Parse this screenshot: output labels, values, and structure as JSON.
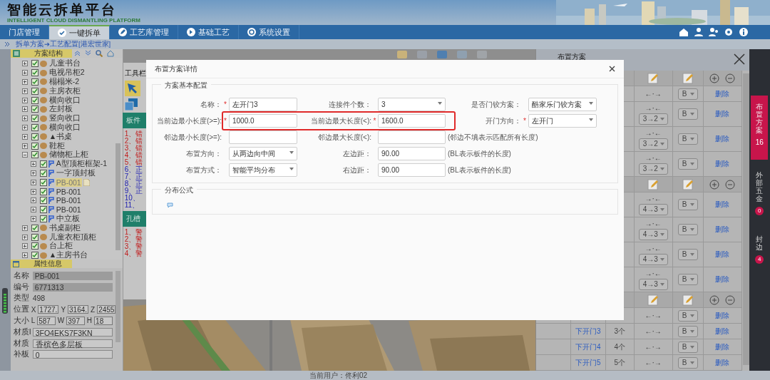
{
  "header": {
    "title": "智能云拆单平台",
    "subtitle": "INTELLIGENT CLOUD DISMANTLING PLATFORM"
  },
  "nav": [
    {
      "label": "门店管理",
      "selected": false
    },
    {
      "label": "一键拆单",
      "selected": true
    },
    {
      "label": "工艺库管理",
      "selected": false
    },
    {
      "label": "基础工艺",
      "selected": false
    },
    {
      "label": "系统设置",
      "selected": false
    }
  ],
  "breadcrumb": "拆单方案➔工艺配置[港宏世家]",
  "tree": {
    "title": "方案结构",
    "items": [
      {
        "label": "儿童书台",
        "kind": "cabinet",
        "checked": true,
        "expanded": false,
        "selected": false
      },
      {
        "label": "电视吊柜2",
        "kind": "cabinet",
        "checked": true,
        "expanded": false,
        "selected": false
      },
      {
        "label": "榻榻米-2",
        "kind": "cabinet",
        "checked": true,
        "expanded": false,
        "selected": false
      },
      {
        "label": "主房衣柜",
        "kind": "cabinet",
        "checked": true,
        "expanded": false,
        "selected": false
      },
      {
        "label": "横向收口",
        "kind": "cabinet",
        "checked": true,
        "expanded": false,
        "selected": false
      },
      {
        "label": "左封板",
        "kind": "cabinet",
        "checked": true,
        "expanded": false,
        "selected": false
      },
      {
        "label": "竖向收口",
        "kind": "cabinet",
        "checked": true,
        "expanded": false,
        "selected": false
      },
      {
        "label": "横向收口",
        "kind": "cabinet",
        "checked": true,
        "expanded": false,
        "selected": false
      },
      {
        "label": "▲书桌",
        "kind": "cabinet",
        "checked": true,
        "expanded": false,
        "selected": false
      },
      {
        "label": "鞋柜",
        "kind": "cabinet",
        "checked": true,
        "expanded": false,
        "selected": false
      },
      {
        "label": "储物柜上柜",
        "kind": "cabinet",
        "checked": true,
        "expanded": true,
        "selected": false,
        "children": [
          {
            "label": "A型顶柜框架-1",
            "kind": "panel",
            "checked": true,
            "expanded": false,
            "selected": false
          },
          {
            "label": "一字顶封板",
            "kind": "panel",
            "checked": true,
            "expanded": false,
            "selected": false
          },
          {
            "label": "PB-001",
            "kind": "panel",
            "checked": true,
            "expanded": false,
            "selected": true
          },
          {
            "label": "PB-001",
            "kind": "panel",
            "checked": true,
            "expanded": false,
            "selected": false
          },
          {
            "label": "PB-001",
            "kind": "panel",
            "checked": true,
            "expanded": false,
            "selected": false
          },
          {
            "label": "PB-001",
            "kind": "panel",
            "checked": true,
            "expanded": false,
            "selected": false
          },
          {
            "label": "中立板",
            "kind": "panel",
            "checked": true,
            "expanded": false,
            "selected": false
          }
        ]
      },
      {
        "label": "书桌副柜",
        "kind": "cabinet",
        "checked": true,
        "expanded": false,
        "selected": false
      },
      {
        "label": "儿童衣柜顶柜",
        "kind": "cabinet",
        "checked": true,
        "expanded": false,
        "selected": false
      },
      {
        "label": "台上柜",
        "kind": "cabinet",
        "checked": true,
        "expanded": false,
        "selected": false
      },
      {
        "label": "▲主房书台",
        "kind": "cabinet",
        "checked": true,
        "expanded": false,
        "selected": false
      }
    ]
  },
  "properties": {
    "title": "属性信息",
    "rows": [
      {
        "label": "名称",
        "kind": "readonly",
        "value": "PB-001"
      },
      {
        "label": "编号",
        "kind": "readonly",
        "value": "6771313"
      },
      {
        "label": "类型",
        "kind": "text",
        "value": "498"
      },
      {
        "label": "位置",
        "kind": "parts",
        "parts": [
          {
            "axis": "X",
            "value": "1727."
          },
          {
            "axis": "Y",
            "value": "3164."
          },
          {
            "axis": "Z",
            "value": "2455"
          }
        ]
      },
      {
        "label": "大小",
        "kind": "parts",
        "parts": [
          {
            "axis": "L",
            "value": "587"
          },
          {
            "axis": "W",
            "value": "397"
          },
          {
            "axis": "H",
            "value": "18"
          }
        ]
      },
      {
        "label": "材质I",
        "kind": "input",
        "value": "3FO4EKS7F3KN"
      },
      {
        "label": "材质",
        "kind": "input",
        "value": "香槟色多层板"
      },
      {
        "label": "补板",
        "kind": "input",
        "value": "0"
      }
    ]
  },
  "toolbox": {
    "label": "工具栏",
    "sections": [
      {
        "title": "板件",
        "lines": [
          {
            "text": "1、错",
            "kind": "error"
          },
          {
            "text": "2、错",
            "kind": "error"
          },
          {
            "text": "3、错",
            "kind": "error"
          },
          {
            "text": "4、错",
            "kind": "error"
          },
          {
            "text": "5、错",
            "kind": "error"
          },
          {
            "text": "6、正",
            "kind": "normal"
          },
          {
            "text": "7、正",
            "kind": "normal"
          },
          {
            "text": "8、正",
            "kind": "normal"
          },
          {
            "text": "9、正",
            "kind": "normal"
          },
          {
            "text": "10、",
            "kind": "normal"
          },
          {
            "text": "11、",
            "kind": "normal"
          }
        ]
      },
      {
        "title": "孔槽",
        "lines": [
          {
            "text": "1、警",
            "kind": "error"
          },
          {
            "text": "2、警",
            "kind": "error"
          },
          {
            "text": "3、警",
            "kind": "error"
          },
          {
            "text": "4、警",
            "kind": "error"
          }
        ]
      }
    ]
  },
  "panel": {
    "title": "布置方案",
    "rows": [
      {
        "kind": "group"
      },
      {
        "kind": "item",
        "arrows": "←·→",
        "side": "B",
        "action": "删除"
      },
      {
        "kind": "item",
        "arrows": "→·←",
        "order": "3→2",
        "side": "B",
        "action": "删除"
      },
      {
        "kind": "item",
        "arrows": "→·←",
        "order": "3→2",
        "side": "B",
        "action": "删除"
      },
      {
        "kind": "item",
        "arrows": "→·←",
        "order": "3→2",
        "side": "B",
        "action": "删除"
      },
      {
        "kind": "group"
      },
      {
        "kind": "item",
        "arrows": "→·←",
        "order": "4→3",
        "side": "B",
        "action": "删除"
      },
      {
        "kind": "item",
        "arrows": "→·←",
        "order": "4→3",
        "side": "B",
        "action": "删除"
      },
      {
        "kind": "item",
        "arrows": "→·←",
        "order": "4→3",
        "side": "B",
        "action": "删除"
      },
      {
        "kind": "item",
        "arrows": "→·←",
        "order": "4→3",
        "side": "B",
        "action": "删除"
      },
      {
        "kind": "group"
      },
      {
        "kind": "item",
        "arrows": "←·→",
        "side": "B",
        "action": "删除"
      },
      {
        "kind": "item",
        "name": "下开门3",
        "count": "3个",
        "arrows": "←·→",
        "side": "B",
        "action": "删除"
      },
      {
        "kind": "item",
        "name": "下开门4",
        "count": "4个",
        "arrows": "←·→",
        "side": "B",
        "action": "删除"
      },
      {
        "kind": "item",
        "name": "下开门5",
        "count": "5个",
        "arrows": "←·→",
        "side": "B",
        "action": "删除"
      }
    ]
  },
  "sidebar": [
    {
      "label": "布置方案",
      "badge": "16",
      "selected": true
    },
    {
      "label": "外部五金",
      "badge": "0",
      "selected": false
    },
    {
      "label": "封边",
      "badge": "4",
      "selected": false
    }
  ],
  "modal": {
    "title": "布置方案详情",
    "sections": [
      {
        "title": "方案基本配置",
        "rows": [
          {
            "highlighted": false,
            "fields": [
              {
                "label": "名称：",
                "mark": "*",
                "kind": "text",
                "value": "左开门3"
              },
              {
                "label": "连接件个数：",
                "kind": "select",
                "value": "3"
              },
              {
                "label": "是否门铰方案：",
                "kind": "select",
                "value": "酷家乐门铰方案"
              }
            ]
          },
          {
            "highlighted": true,
            "fields": [
              {
                "label": "当前边最小长度(>=):",
                "mark": "*",
                "kind": "text",
                "value": "1000.0"
              },
              {
                "label": "当前边最大长度(<):",
                "mark": "*",
                "kind": "text",
                "value": "1600.0"
              },
              {
                "label": "开门方向：",
                "mark": "*",
                "kind": "select",
                "value": "左开门"
              }
            ]
          },
          {
            "highlighted": false,
            "fields": [
              {
                "label": "邻边最小长度(>=):",
                "kind": "text"
              },
              {
                "label": "邻边最大长度(<):",
                "kind": "text"
              }
            ],
            "note": "(邻边不填表示匹配所有长度)"
          },
          {
            "highlighted": false,
            "fields": [
              {
                "label": "布置方向：",
                "kind": "select",
                "value": "从两边向中间"
              },
              {
                "label": "左边距：",
                "kind": "text",
                "value": "90.00"
              }
            ],
            "note": "(BL表示板件的长度)"
          },
          {
            "highlighted": false,
            "fields": [
              {
                "label": "布置方式：",
                "kind": "select",
                "value": "智能平均分布"
              },
              {
                "label": "右边距：",
                "kind": "text",
                "value": "90.00"
              }
            ],
            "note": "(BL表示板件的长度)"
          }
        ]
      },
      {
        "title": "分布公式"
      }
    ]
  },
  "status": {
    "user": "当前用户：佟利02"
  }
}
